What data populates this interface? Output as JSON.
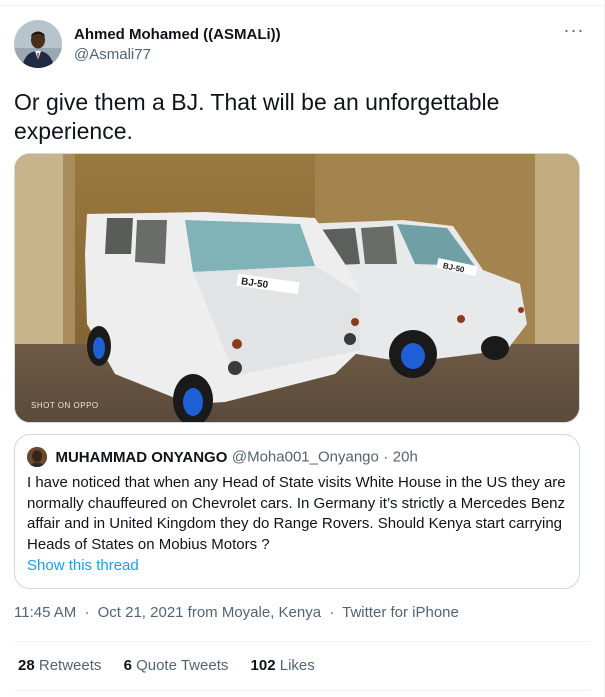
{
  "author": {
    "display_name": "Ahmed Mohamed ((ASMALi))",
    "handle": "@Asmali77"
  },
  "tweet": {
    "text": "Or give them a BJ. That will be an unforgettable experience."
  },
  "media": {
    "plate_left": "BJ-50",
    "plate_right": "BJ-50",
    "watermark": "SHOT ON OPPO"
  },
  "quoted_tweet": {
    "display_name": "MUHAMMAD ONYANGO",
    "handle": "@Moha001_Onyango",
    "separator": "·",
    "time": "20h",
    "text": "I have noticed that when any Head of State visits White House in the US they are normally chauffeured on Chevrolet cars. In Germany it’s strictly a Mercedes Benz affair and in United Kingdom they do Range Rovers. Should Kenya start carrying Heads of States on Mobius Motors ?",
    "show_thread_label": "Show this thread"
  },
  "meta": {
    "time": "11:45 AM",
    "date": "Oct 21, 2021 from Moyale, Kenya",
    "separator": "·",
    "source": "Twitter for iPhone"
  },
  "stats": {
    "retweets_count": "28",
    "retweets_label": "Retweets",
    "quotes_count": "6",
    "quotes_label": "Quote Tweets",
    "likes_count": "102",
    "likes_label": "Likes"
  },
  "icons": {
    "more": "more-dots-icon"
  },
  "colors": {
    "link": "#1d9bf0",
    "secondary_text": "#536471",
    "border": "#cfd9de"
  }
}
